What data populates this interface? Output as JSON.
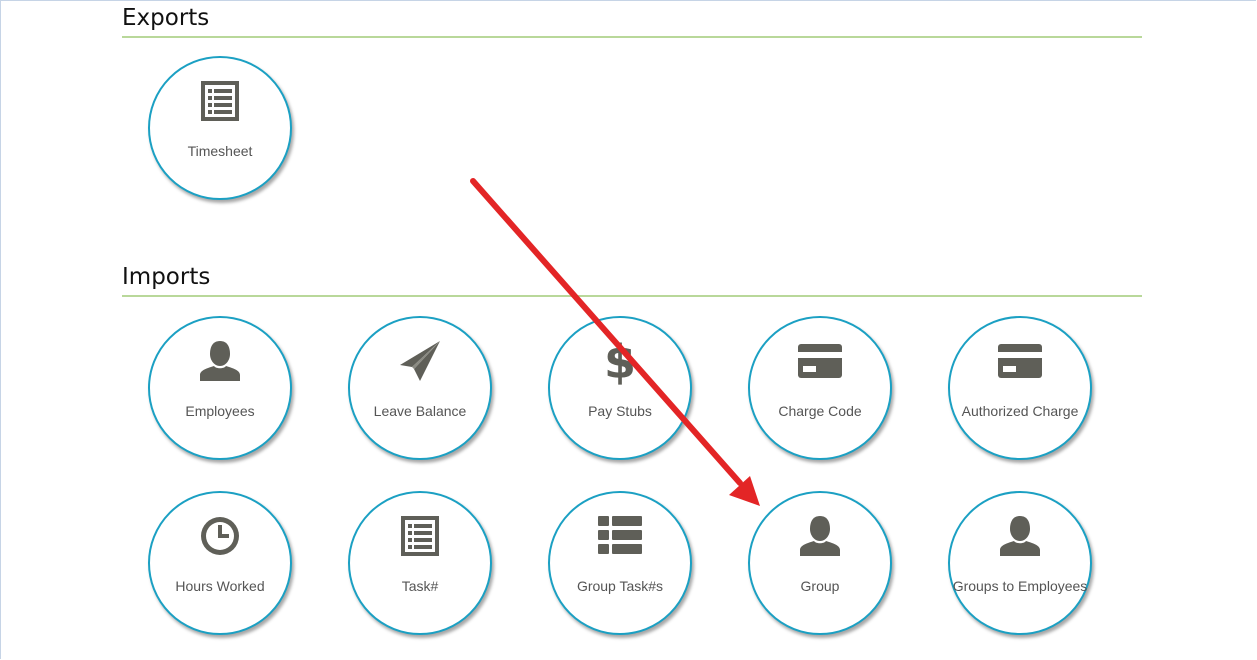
{
  "exports": {
    "title": "Exports",
    "tiles": [
      {
        "label": "Timesheet",
        "icon": "list-icon"
      }
    ]
  },
  "imports": {
    "title": "Imports",
    "tiles": [
      {
        "label": "Employees",
        "icon": "user-icon"
      },
      {
        "label": "Leave Balance",
        "icon": "paper-plane-icon"
      },
      {
        "label": "Pay Stubs",
        "icon": "dollar-icon"
      },
      {
        "label": "Charge Code",
        "icon": "credit-card-icon"
      },
      {
        "label": "Authorized Charge",
        "icon": "credit-card-icon"
      },
      {
        "label": "Hours Worked",
        "icon": "clock-icon"
      },
      {
        "label": "Task#",
        "icon": "list-icon"
      },
      {
        "label": "Group Task#s",
        "icon": "th-list-icon"
      },
      {
        "label": "Group",
        "icon": "user-icon"
      },
      {
        "label": "Groups to Employees",
        "icon": "user-icon"
      }
    ]
  },
  "colors": {
    "tile_border": "#1ba0c3",
    "icon": "#5f5f58",
    "section_underline": "#b9d89a",
    "annotation_arrow": "#e32526"
  }
}
